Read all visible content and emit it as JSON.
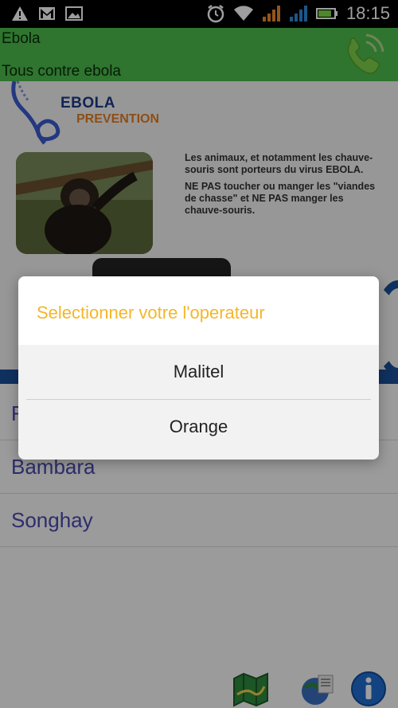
{
  "status_bar": {
    "time": "18:15",
    "left_icons": [
      "warning-icon",
      "gmail-icon",
      "image-icon"
    ],
    "right_icons": [
      "alarm-icon",
      "wifi-icon",
      "signal-orange-icon",
      "signal-blue-icon",
      "battery-icon"
    ]
  },
  "header": {
    "title": "Ebola",
    "subtitle": "Tous contre ebola",
    "phone_icon": "phone-icon"
  },
  "banner": {
    "logo_line1": "EBOLA",
    "logo_line2": "PREVENTION",
    "text_p1": "Les animaux, et notamment les chauve-souris sont porteurs du virus EBOLA.",
    "text_p2": "NE PAS toucher ou manger les \"viandes de chasse\" et NE PAS manger les chauve-souris."
  },
  "languages": [
    {
      "label": "F"
    },
    {
      "label": "Bambara"
    },
    {
      "label": "Songhay"
    }
  ],
  "bottom_icons": [
    "map-icon",
    "globe-icon",
    "info-icon"
  ],
  "dialog": {
    "title": "Selectionner votre l'operateur",
    "options": [
      "Malitel",
      "Orange"
    ]
  },
  "colors": {
    "header_bg": "#4cbb4c",
    "dialog_title": "#f5b62a",
    "list_text": "#4a4ab0"
  }
}
